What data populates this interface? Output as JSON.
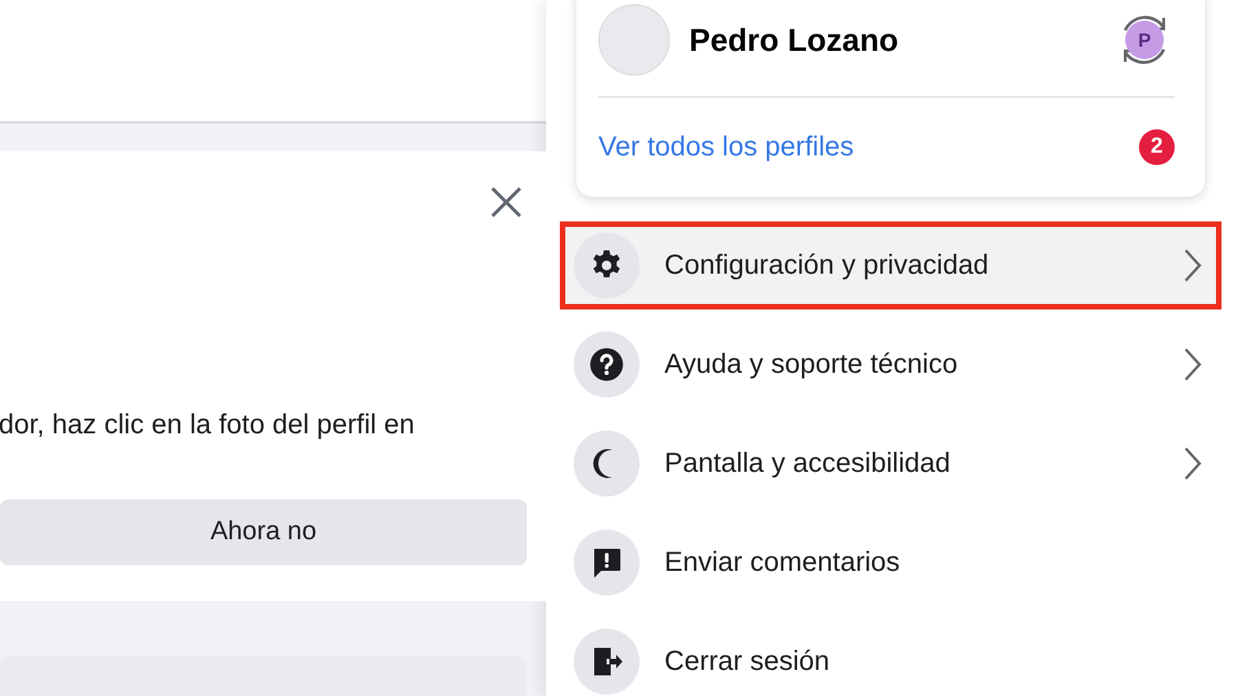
{
  "dialog": {
    "text": "dor, haz clic en la foto del perfil en",
    "button": "Ahora no"
  },
  "profile_card": {
    "name": "Pedro Lozano",
    "avatar_letter": "P",
    "link": "Ver todos los perfiles",
    "badge": "2"
  },
  "menu": [
    {
      "label": "Configuración y privacidad",
      "chevron": true,
      "highlighted": true
    },
    {
      "label": "Ayuda y soporte técnico",
      "chevron": true,
      "highlighted": false
    },
    {
      "label": "Pantalla y accesibilidad",
      "chevron": true,
      "highlighted": false
    },
    {
      "label": "Enviar comentarios",
      "chevron": false,
      "highlighted": false
    },
    {
      "label": "Cerrar sesión",
      "chevron": false,
      "highlighted": false
    }
  ]
}
